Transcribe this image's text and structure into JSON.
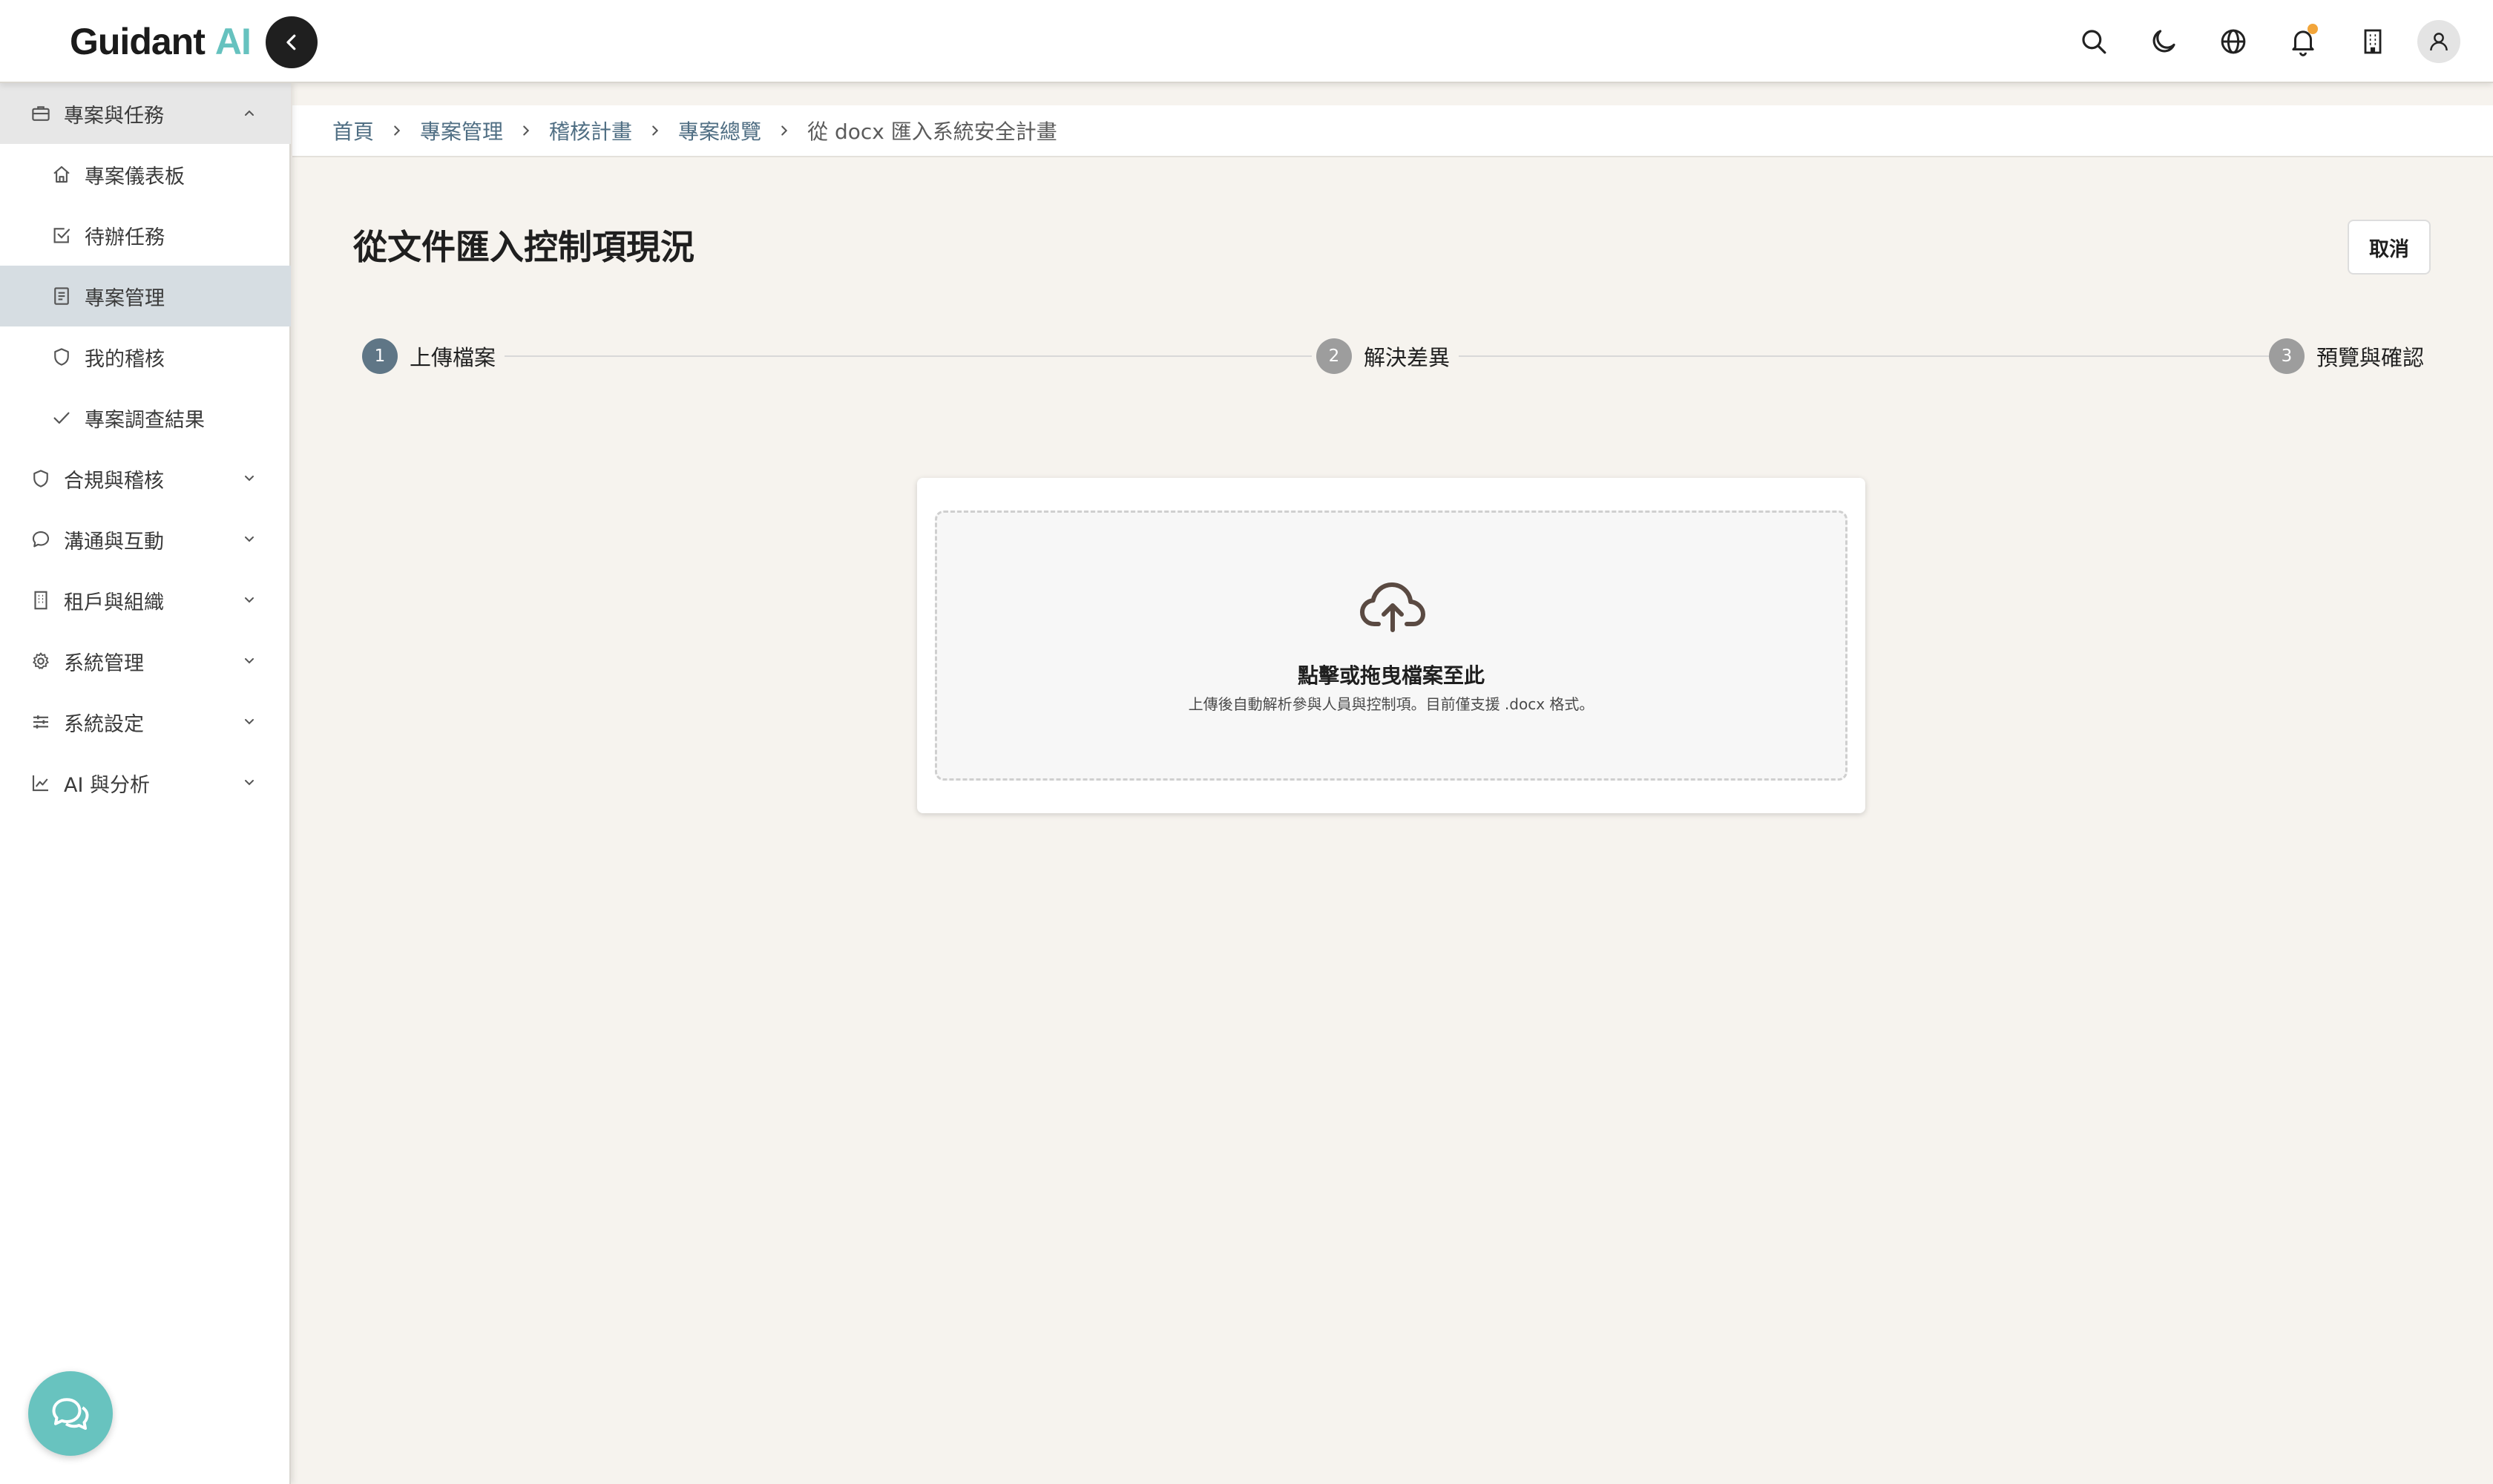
{
  "app": {
    "brand_name": "Guidant",
    "brand_suffix": "AI",
    "brand_suffix_color": "#66c2bf"
  },
  "topbar": {
    "icons": [
      "search-icon",
      "moon-icon",
      "globe-icon",
      "bell-icon",
      "building-icon",
      "user-icon"
    ],
    "notification_dot_color": "#f2a53a"
  },
  "sidebar": {
    "active_color": "#d6dde2",
    "items": [
      {
        "label": "專案與任務",
        "icon": "briefcase-icon",
        "type": "group",
        "expanded": true
      },
      {
        "label": "專案儀表板",
        "icon": "home-icon",
        "type": "sub"
      },
      {
        "label": "待辦任務",
        "icon": "checkbox-icon",
        "type": "sub"
      },
      {
        "label": "專案管理",
        "icon": "document-icon",
        "type": "sub",
        "active": true
      },
      {
        "label": "我的稽核",
        "icon": "shield-icon",
        "type": "sub"
      },
      {
        "label": "專案調查結果",
        "icon": "check-icon",
        "type": "sub"
      },
      {
        "label": "合規與稽核",
        "icon": "shield-icon",
        "type": "group"
      },
      {
        "label": "溝通與互動",
        "icon": "chat-icon",
        "type": "group"
      },
      {
        "label": "租戶與組織",
        "icon": "building-icon",
        "type": "group"
      },
      {
        "label": "系統管理",
        "icon": "gear-icon",
        "type": "group"
      },
      {
        "label": "系統設定",
        "icon": "sliders-icon",
        "type": "group"
      },
      {
        "label": "AI 與分析",
        "icon": "chart-line-icon",
        "type": "group"
      }
    ]
  },
  "breadcrumb": [
    "首頁",
    "專案管理",
    "稽核計畫",
    "專案總覽",
    "從 docx 匯入系統安全計畫"
  ],
  "page": {
    "title": "從文件匯入控制項現況",
    "cancel_label": "取消"
  },
  "stepper": {
    "steps": [
      {
        "number": "1",
        "label": "上傳檔案",
        "active": true
      },
      {
        "number": "2",
        "label": "解決差異",
        "active": false
      },
      {
        "number": "3",
        "label": "預覽與確認",
        "active": false
      }
    ]
  },
  "upload": {
    "title": "點擊或拖曳檔案至此",
    "hint": "上傳後自動解析參與人員與控制項。目前僅支援 .docx 格式。",
    "icon": "cloud-upload-icon"
  },
  "chat_fab": {
    "icon": "chat-bubbles-icon",
    "color": "#68c3bf"
  }
}
